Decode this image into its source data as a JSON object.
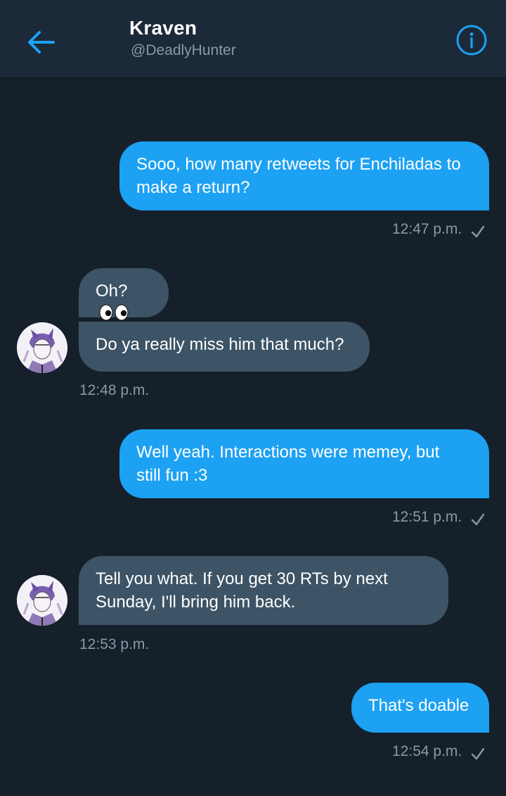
{
  "header": {
    "name": "Kraven",
    "handle": "@DeadlyHunter",
    "back_icon": "arrow-left-icon",
    "info_icon": "info-circle-icon"
  },
  "colors": {
    "background": "#15202b",
    "header": "#1c2938",
    "accent": "#1da1f2",
    "incoming_bubble": "#3d5466",
    "muted_text": "#8899a6"
  },
  "messages": [
    {
      "direction": "outgoing",
      "lines": [
        "Sooo, how many retweets for Enchiladas to",
        "make a return?"
      ],
      "time": "12:47 p.m.",
      "status_icon": "checkmark-icon"
    },
    {
      "direction": "incoming",
      "group": [
        {
          "text": "Oh?",
          "emoji": "eyes-emoji"
        },
        {
          "text": "Do ya really miss him that much?"
        }
      ],
      "time": "12:48 p.m.",
      "avatar": "avatar-icon"
    },
    {
      "direction": "outgoing",
      "lines": [
        "Well yeah. Interactions were memey, but",
        "still fun :3"
      ],
      "time": "12:51 p.m.",
      "status_icon": "checkmark-icon"
    },
    {
      "direction": "incoming",
      "lines": [
        "Tell you what. If you get 30 RTs by next",
        "Sunday, I'll bring him back."
      ],
      "time": "12:53 p.m.",
      "avatar": "avatar-icon"
    },
    {
      "direction": "outgoing",
      "lines": [
        "That's doable"
      ],
      "time": "12:54 p.m.",
      "status_icon": "checkmark-icon"
    }
  ]
}
